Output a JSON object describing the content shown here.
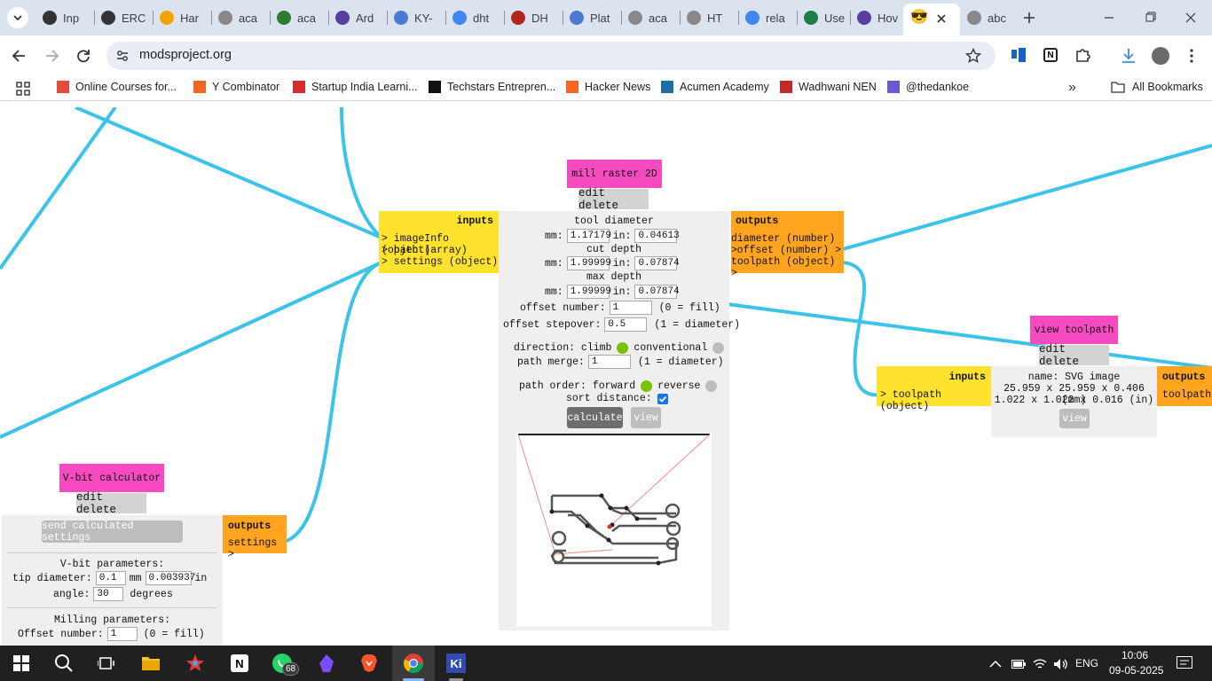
{
  "tabs": [
    {
      "label": "Inp",
      "icon": "openai-icon",
      "color": "#333"
    },
    {
      "label": "ERC",
      "icon": "openai-icon",
      "color": "#333"
    },
    {
      "label": "Har",
      "icon": "hackster-icon",
      "color": "#f3a300"
    },
    {
      "label": "aca",
      "icon": "globe-icon",
      "color": "#888"
    },
    {
      "label": "aca",
      "icon": "cube-icon",
      "color": "#2e7d32"
    },
    {
      "label": "Ard",
      "icon": "k-icon",
      "color": "#5a3fa0"
    },
    {
      "label": "KY-",
      "icon": "h-icon",
      "color": "#4a7bd0"
    },
    {
      "label": "dht",
      "icon": "google-icon",
      "color": "#4285f4"
    },
    {
      "label": "DH",
      "icon": "e-icon",
      "color": "#b3261e"
    },
    {
      "label": "Plat",
      "icon": "h-icon",
      "color": "#4a7bd0"
    },
    {
      "label": "aca",
      "icon": "globe-icon",
      "color": "#888"
    },
    {
      "label": "HT",
      "icon": "globe-icon",
      "color": "#888"
    },
    {
      "label": "rela",
      "icon": "google-icon",
      "color": "#4285f4"
    },
    {
      "label": "Use",
      "icon": "site-icon",
      "color": "#1e7d4a"
    },
    {
      "label": "Hov",
      "icon": "k-icon",
      "color": "#5a3fa0"
    },
    {
      "label": "",
      "icon": "sunglasses-emoji-icon",
      "color": "#f4c542"
    },
    {
      "label": "abc",
      "icon": "globe-icon",
      "color": "#888"
    }
  ],
  "browser": {
    "url": "modsproject.org",
    "bookmarks": [
      {
        "label": "Online Courses for...",
        "color": "#e34b3c"
      },
      {
        "label": "Y Combinator",
        "color": "#f26522"
      },
      {
        "label": "Startup India Learni...",
        "color": "#d32f2f"
      },
      {
        "label": "Techstars Entrepren...",
        "color": "#111"
      },
      {
        "label": "Hacker News",
        "color": "#f26522"
      },
      {
        "label": "Acumen Academy",
        "color": "#1b6ea8"
      },
      {
        "label": "Wadhwani NEN",
        "color": "#c62828"
      },
      {
        "label": "@thedankoe",
        "color": "#6a5acd"
      }
    ],
    "all_bookmarks": "All Bookmarks",
    "more": "»"
  },
  "mill": {
    "title": "mill raster 2D",
    "edit_delete": "edit delete",
    "inputs_title": "inputs",
    "inputs": [
      "> imageInfo (object)",
      "> path (array)",
      "> settings (object)"
    ],
    "outputs_title": "outputs",
    "outputs": [
      "diameter (number) >",
      "offset (number) >",
      "toolpath (object) >"
    ],
    "tool_diameter": "tool diameter",
    "mm": "mm:",
    "in": "in:",
    "tool_mm": "1.17179",
    "tool_in": "0.04613",
    "cut_depth": "cut depth",
    "cut_mm": "1.99999",
    "cut_in": "0.07874",
    "max_depth": "max depth",
    "max_mm": "1.99999",
    "max_in": "0.07874",
    "offset_number_label": "offset number:",
    "offset_number": "1",
    "offset_number_note": "(0 = fill)",
    "offset_stepover_label": "offset stepover:",
    "offset_stepover": "0.5",
    "offset_stepover_note": "(1 = diameter)",
    "direction_label": "direction: climb",
    "conventional": "conventional",
    "path_merge_label": "path merge:",
    "path_merge": "1",
    "path_merge_note": "(1 = diameter)",
    "path_order_label": "path order: forward",
    "reverse": "reverse",
    "sort_distance": "sort distance:",
    "calculate": "calculate",
    "view": "view"
  },
  "viewtp": {
    "title": "view toolpath",
    "edit_delete": "edit delete",
    "inputs_title": "inputs",
    "input": "> toolpath (object)",
    "outputs_title": "outputs",
    "output": "toolpath",
    "name": "name: SVG image",
    "mm": "25.959 x 25.959 x 0.406 (mm)",
    "in": "1.022 x 1.022 x 0.016 (in)",
    "view": "view"
  },
  "vbit": {
    "title": "V-bit calculator",
    "edit_delete": "edit delete",
    "send": "send calculated settings",
    "outputs_title": "outputs",
    "output": "settings >",
    "params_title": "V-bit parameters:",
    "tip_label": "tip diameter:",
    "tip_mm": "0.1",
    "mm": "mm",
    "tip_in": "0.003937",
    "in": "in",
    "angle_label": "angle:",
    "angle": "30",
    "degrees": "degrees",
    "milling_title": "Milling parameters:",
    "offset_label": "Offset number:",
    "offset": "1",
    "offset_note": "(0 = fill)"
  },
  "taskbar": {
    "whatsapp_badge": "68",
    "lang": "ENG",
    "time": "10:06",
    "date": "09-05-2025"
  },
  "colors": {
    "wire": "#3cc3ea",
    "pink": "#f64bc0",
    "yellow": "#ffe22e",
    "orange": "#ffa41e",
    "green": "#7ac200"
  }
}
